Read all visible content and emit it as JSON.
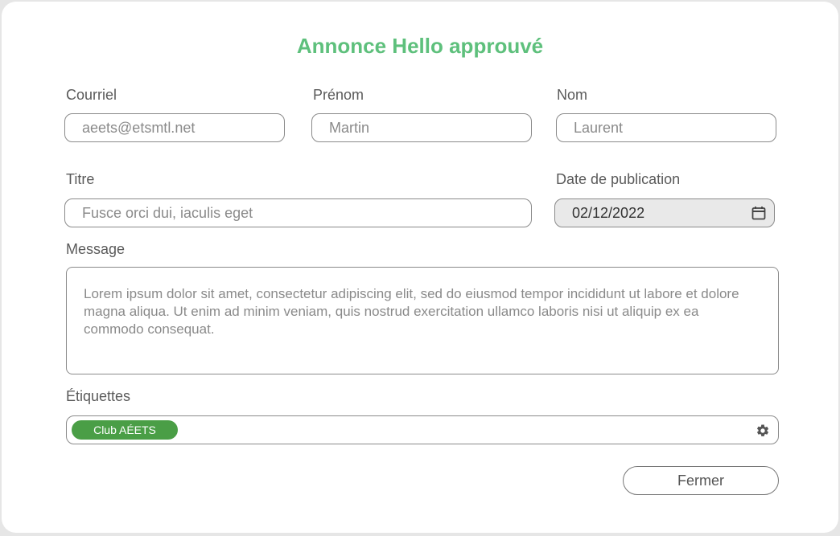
{
  "dialog": {
    "title": "Annonce Hello approuvé",
    "email": {
      "label": "Courriel",
      "value": "aeets@etsmtl.net"
    },
    "first_name": {
      "label": "Prénom",
      "value": "Martin"
    },
    "last_name": {
      "label": "Nom",
      "value": "Laurent"
    },
    "titre": {
      "label": "Titre",
      "value": "Fusce orci dui, iaculis eget"
    },
    "publication_date": {
      "label": "Date de publication",
      "value": "02/12/2022"
    },
    "message": {
      "label": "Message",
      "value": "Lorem ipsum dolor sit amet, consectetur adipiscing elit, sed do eiusmod tempor incididunt ut labore et dolore magna aliqua. Ut enim ad minim veniam, quis nostrud exercitation ullamco laboris nisi ut aliquip ex ea commodo consequat."
    },
    "tags": {
      "label": "Étiquettes",
      "items": [
        "Club AÉETS"
      ]
    },
    "close_label": "Fermer"
  },
  "colors": {
    "title": "#5ec07c",
    "chip": "#4a9e46",
    "date_bg": "#e9e9e9"
  },
  "icons": {
    "calendar": "calendar-icon",
    "settings": "gear-icon"
  }
}
